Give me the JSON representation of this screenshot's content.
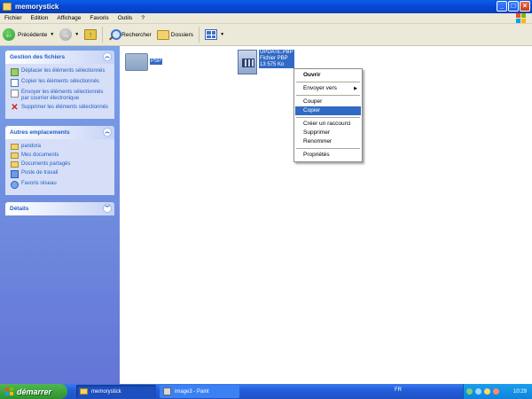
{
  "window": {
    "title": "memorystick"
  },
  "menubar": {
    "items": [
      "Fichier",
      "Edition",
      "Affichage",
      "Favoris",
      "Outils",
      "?"
    ]
  },
  "toolbar": {
    "back_label": "Précédente",
    "search_label": "Rechercher",
    "folders_label": "Dossiers"
  },
  "sidebar": {
    "file_tasks": {
      "title": "Gestion des fichiers",
      "items": [
        "Déplacer les éléments sélectionnés",
        "Copier les éléments sélectionnés",
        "Envoyer les éléments sélectionnés par courrier électronique",
        "Supprimer les éléments sélectionnés"
      ]
    },
    "other_places": {
      "title": "Autres emplacements",
      "items": [
        "pandora",
        "Mes documents",
        "Documents partagés",
        "Poste de travail",
        "Favoris réseau"
      ]
    },
    "details": {
      "title": "Détails"
    }
  },
  "files": [
    {
      "name": "PSP"
    },
    {
      "name": "UPDATE.PBP",
      "type": "Fichier PBP",
      "size": "13 575 Ko"
    }
  ],
  "context_menu": {
    "items": [
      "Ouvrir",
      "Envoyer vers",
      "Couper",
      "Copier",
      "Créer un raccourci",
      "Supprimer",
      "Renommer",
      "Propriétés"
    ]
  },
  "taskbar": {
    "start_label": "démarrer",
    "tasks": [
      "memorystick",
      "image3 - Paint"
    ],
    "language": "FR",
    "clock": "10:29"
  }
}
